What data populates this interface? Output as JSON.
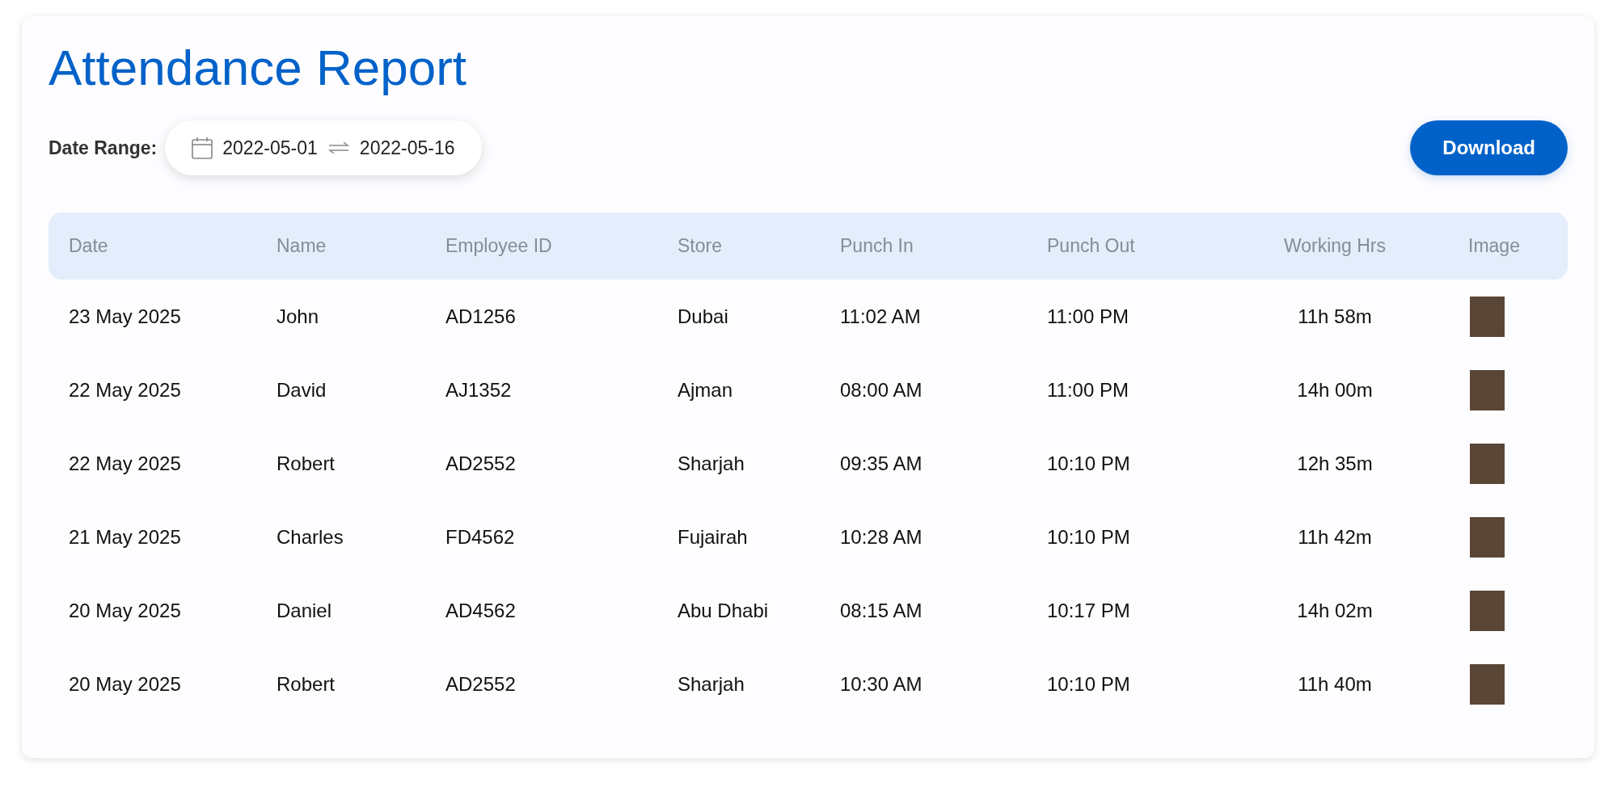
{
  "title": "Attendance Report",
  "date_range": {
    "label": "Date Range:",
    "start": "2022-05-01",
    "end": "2022-05-16"
  },
  "download_button": "Download",
  "table": {
    "columns": [
      "Date",
      "Name",
      "Employee ID",
      "Store",
      "Punch In",
      "Punch Out",
      "Working Hrs",
      "Image"
    ],
    "rows": [
      {
        "date": "23 May 2025",
        "name": "John",
        "employee_id": "AD1256",
        "store": "Dubai",
        "punch_in": "11:02 AM",
        "punch_out": "11:00 PM",
        "working_hrs": "11h 58m"
      },
      {
        "date": "22 May 2025",
        "name": "David",
        "employee_id": "AJ1352",
        "store": "Ajman",
        "punch_in": "08:00 AM",
        "punch_out": "11:00 PM",
        "working_hrs": "14h 00m"
      },
      {
        "date": "22 May 2025",
        "name": "Robert",
        "employee_id": "AD2552",
        "store": "Sharjah",
        "punch_in": "09:35 AM",
        "punch_out": "10:10 PM",
        "working_hrs": "12h 35m"
      },
      {
        "date": "21 May 2025",
        "name": "Charles",
        "employee_id": "FD4562",
        "store": "Fujairah",
        "punch_in": "10:28 AM",
        "punch_out": "10:10 PM",
        "working_hrs": "11h 42m"
      },
      {
        "date": "20 May 2025",
        "name": "Daniel",
        "employee_id": "AD4562",
        "store": "Abu Dhabi",
        "punch_in": "08:15 AM",
        "punch_out": "10:17 PM",
        "working_hrs": "14h 02m"
      },
      {
        "date": "20 May 2025",
        "name": "Robert",
        "employee_id": "AD2552",
        "store": "Sharjah",
        "punch_in": "10:30 AM",
        "punch_out": "10:10 PM",
        "working_hrs": "11h 40m"
      }
    ]
  }
}
